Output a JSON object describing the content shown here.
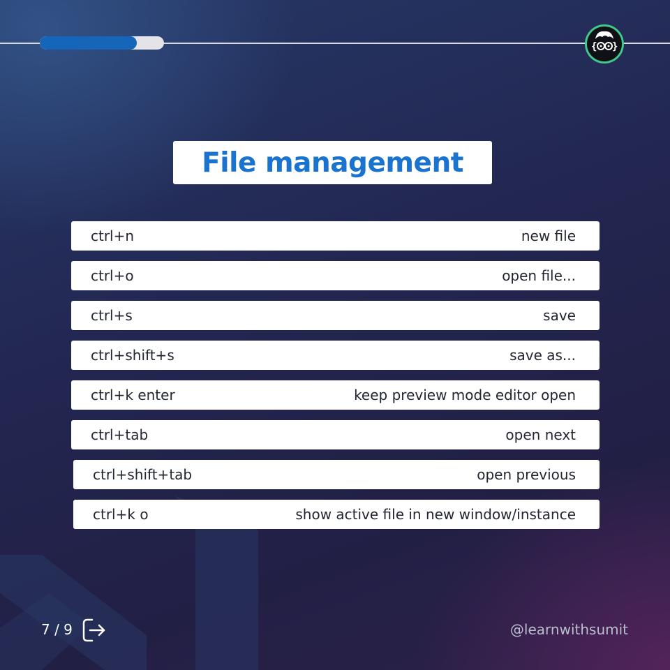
{
  "progress": {
    "fraction": 0.78
  },
  "logo": {
    "icon": "developer-avatar-icon",
    "accent": "#40c98a"
  },
  "title": "File management",
  "shortcuts": [
    {
      "key": "ctrl+n",
      "desc": "new file"
    },
    {
      "key": "ctrl+o",
      "desc": "open file..."
    },
    {
      "key": "ctrl+s",
      "desc": "save"
    },
    {
      "key": "ctrl+shift+s",
      "desc": "save as..."
    },
    {
      "key": "ctrl+k enter",
      "desc": "keep preview mode editor open"
    },
    {
      "key": "ctrl+tab",
      "desc": "open next"
    },
    {
      "key": "ctrl+shift+tab",
      "desc": "open previous"
    },
    {
      "key": "ctrl+k o",
      "desc": "show active file in new window/instance"
    }
  ],
  "footer": {
    "page": "7 / 9",
    "next_icon": "arrow-right-icon",
    "handle": "@learnwithsumit"
  },
  "colors": {
    "title": "#1a73cf",
    "progress": "#1565b8"
  }
}
